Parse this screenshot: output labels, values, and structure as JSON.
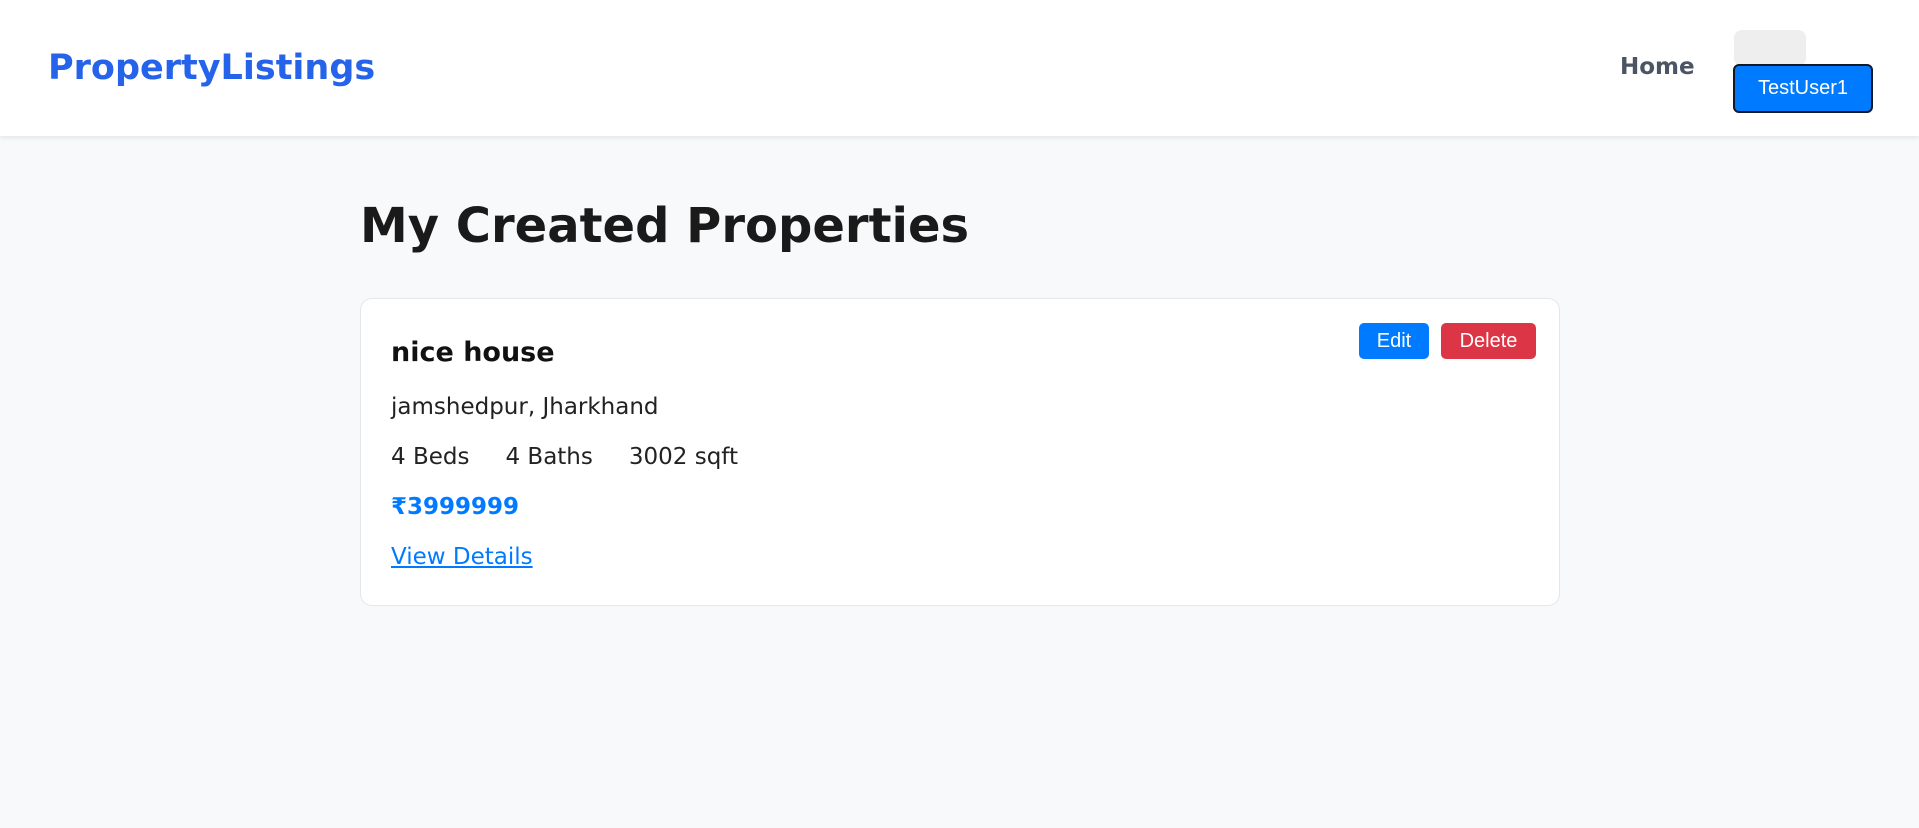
{
  "navbar": {
    "brand": "PropertyListings",
    "links": [
      {
        "label": "Home"
      }
    ],
    "user_button": "TestUser1"
  },
  "main": {
    "title": "My Created Properties",
    "properties": [
      {
        "name": "nice house",
        "location": "jamshedpur, Jharkhand",
        "beds": "4 Beds",
        "baths": "4 Baths",
        "area": "3002 sqft",
        "price": "₹3999999",
        "details_link": "View Details",
        "edit_label": "Edit",
        "delete_label": "Delete"
      }
    ]
  },
  "colors": {
    "brand": "#2563eb",
    "primary": "#007bff",
    "danger": "#dc3545",
    "page_background": "#f8f9fa"
  }
}
